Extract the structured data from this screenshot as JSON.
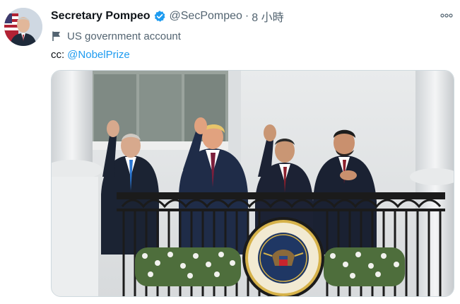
{
  "tweet": {
    "author_name": "Secretary Pompeo",
    "author_handle": "@SecPompeo",
    "separator": "·",
    "time": "8 小時",
    "account_label": "US government account",
    "text_prefix": "cc:",
    "mention": "@NobelPrize",
    "seal_text": "SEAL OF THE PRESIDENT OF THE UNITED STATES"
  },
  "icons": {
    "verified": "verified-badge-icon",
    "flag": "flag-icon",
    "more": "more-options-icon"
  },
  "colors": {
    "link": "#1d9bf0",
    "secondary_text": "#536471",
    "primary_text": "#0f1419"
  }
}
